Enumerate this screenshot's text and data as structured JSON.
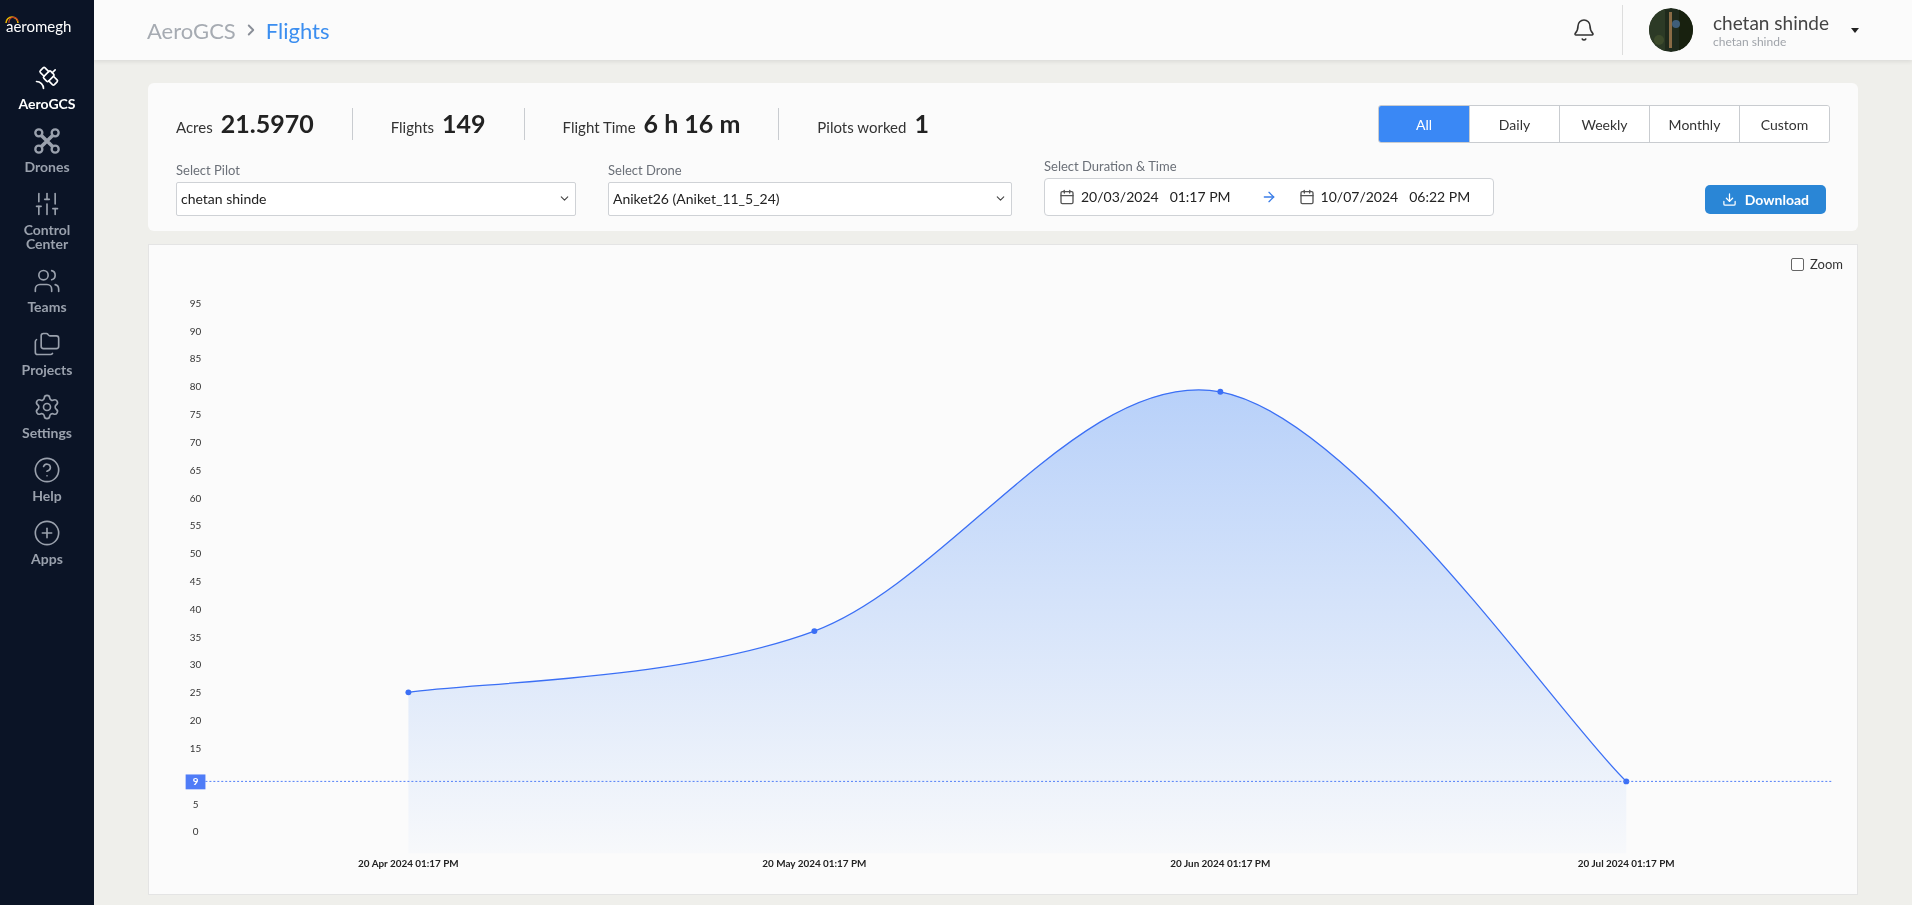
{
  "sidebar": {
    "logo": "aeromegh",
    "items": [
      {
        "label": "AeroGCS",
        "selected": true
      },
      {
        "label": "Drones",
        "selected": false
      },
      {
        "label": "Control Center",
        "selected": false
      },
      {
        "label": "Teams",
        "selected": false
      },
      {
        "label": "Projects",
        "selected": false
      },
      {
        "label": "Settings",
        "selected": false
      },
      {
        "label": "Help",
        "selected": false
      },
      {
        "label": "Apps",
        "selected": false
      }
    ]
  },
  "header": {
    "breadcrumb": [
      "AeroGCS",
      "Flights"
    ],
    "user": {
      "name": "chetan shinde",
      "subtitle": "chetan shinde"
    }
  },
  "stats": [
    {
      "label": "Acres",
      "value": "21.5970"
    },
    {
      "label": "Flights",
      "value": "149"
    },
    {
      "label": "Flight Time",
      "value": "6 h 16 m"
    },
    {
      "label": "Pilots worked",
      "value": "1"
    }
  ],
  "period_tabs": [
    {
      "label": "All",
      "selected": true
    },
    {
      "label": "Daily",
      "selected": false
    },
    {
      "label": "Weekly",
      "selected": false
    },
    {
      "label": "Monthly",
      "selected": false
    },
    {
      "label": "Custom",
      "selected": false
    }
  ],
  "filters": {
    "pilot": {
      "label": "Select Pilot",
      "value": "chetan shinde"
    },
    "drone": {
      "label": "Select Drone",
      "value": "Aniket26 (Aniket_11_5_24)"
    },
    "duration": {
      "label": "Select Duration & Time",
      "from_date": "20/03/2024",
      "from_time": "01:17 PM",
      "to_date": "10/07/2024",
      "to_time": "06:22 PM"
    }
  },
  "download_button": "Download",
  "zoom": {
    "label": "Zoom",
    "checked": false
  },
  "chart": {
    "chart_data": {
      "type": "area",
      "categories": [
        "20 Apr 2024 01:17 PM",
        "20 May 2024 01:17 PM",
        "20 Jun 2024 01:17 PM",
        "20 Jul 2024 01:17 PM"
      ],
      "series": [
        {
          "color": "#3b6ff5",
          "values": [
            25,
            36,
            79,
            9
          ]
        }
      ],
      "ylim": [
        0,
        95
      ],
      "yticks": [
        0,
        5,
        15,
        20,
        25,
        30,
        35,
        40,
        45,
        50,
        55,
        60,
        65,
        70,
        75,
        80,
        85,
        90,
        95
      ],
      "ref_lines": [
        {
          "axis": "y",
          "value": 9,
          "label": "9",
          "color": "#4f7cf7"
        }
      ]
    }
  }
}
